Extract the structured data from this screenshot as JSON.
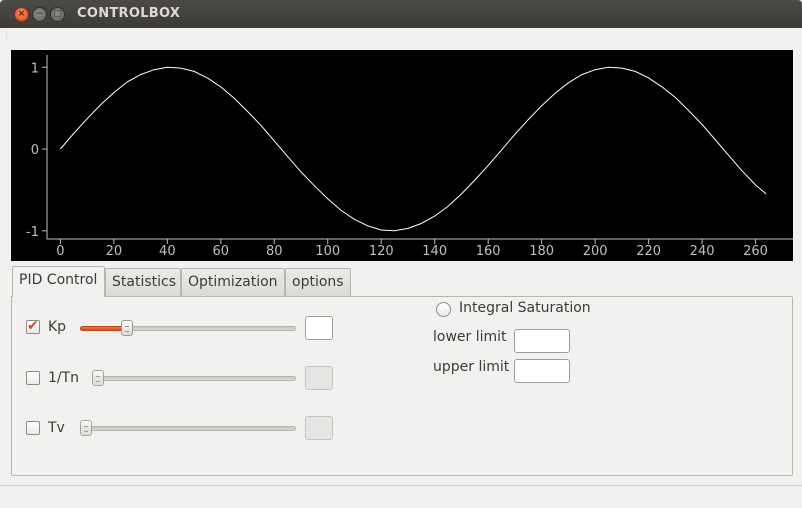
{
  "window": {
    "title": "CONTROLBOX",
    "close_glyph": "×",
    "minimize_glyph": "−",
    "maximize_glyph": "□"
  },
  "chart_data": {
    "type": "line",
    "series": [
      {
        "x": [
          0,
          5,
          10,
          15,
          20,
          25,
          30,
          35,
          40,
          45,
          50,
          55,
          60,
          65,
          70,
          75,
          80,
          85,
          90,
          95,
          100,
          105,
          110,
          115,
          120,
          125,
          130,
          135,
          140,
          145,
          150,
          155,
          160,
          165,
          170,
          175,
          180,
          185,
          190,
          195,
          200,
          205,
          210,
          215,
          220,
          225,
          230,
          235,
          240,
          245,
          250,
          255,
          260,
          264
        ],
        "y": [
          0.0,
          0.19,
          0.37,
          0.54,
          0.69,
          0.82,
          0.91,
          0.97,
          1.0,
          0.99,
          0.95,
          0.87,
          0.76,
          0.62,
          0.46,
          0.29,
          0.1,
          -0.09,
          -0.28,
          -0.45,
          -0.61,
          -0.75,
          -0.86,
          -0.94,
          -0.99,
          -1.0,
          -0.97,
          -0.91,
          -0.82,
          -0.7,
          -0.55,
          -0.38,
          -0.2,
          -0.01,
          0.18,
          0.36,
          0.53,
          0.68,
          0.81,
          0.91,
          0.97,
          1.0,
          0.99,
          0.95,
          0.87,
          0.76,
          0.63,
          0.47,
          0.3,
          0.11,
          -0.08,
          -0.27,
          -0.44,
          -0.55
        ]
      }
    ],
    "xlim": [
      -5,
      274
    ],
    "ylim": [
      -1.1,
      1.15
    ],
    "xticks": [
      "0",
      "20",
      "40",
      "60",
      "80",
      "100",
      "120",
      "140",
      "160",
      "180",
      "200",
      "220",
      "240",
      "260"
    ],
    "xtick_values": [
      0,
      20,
      40,
      60,
      80,
      100,
      120,
      140,
      160,
      180,
      200,
      220,
      240,
      260
    ],
    "yticks": [
      "1",
      "0",
      "-1"
    ],
    "ytick_values": [
      1,
      0,
      -1
    ],
    "background": "#000000",
    "line_color": "#ffffff",
    "axis_color": "#bfbfbf",
    "grid": false
  },
  "tabs": [
    {
      "label": "PID Control",
      "active": true
    },
    {
      "label": "Statistics",
      "active": false
    },
    {
      "label": "Optimization",
      "active": false
    },
    {
      "label": "options",
      "active": false
    }
  ],
  "pid": {
    "kp": {
      "label": "Kp",
      "checked": true,
      "slider_fraction": 0.21,
      "value": ""
    },
    "tn": {
      "label": "1/Tn",
      "checked": false,
      "slider_fraction": 0.0,
      "value": ""
    },
    "tv": {
      "label": "Tv",
      "checked": false,
      "slider_fraction": 0.0,
      "value": ""
    }
  },
  "saturation": {
    "label": "Integral Saturation",
    "selected": false,
    "lower_label": "lower limit",
    "lower_value": "",
    "upper_label": "upper limit",
    "upper_value": ""
  },
  "colors": {
    "accent": "#df4a16",
    "titlebar": "#3c3b37",
    "window_bg": "#f2f1f0"
  }
}
